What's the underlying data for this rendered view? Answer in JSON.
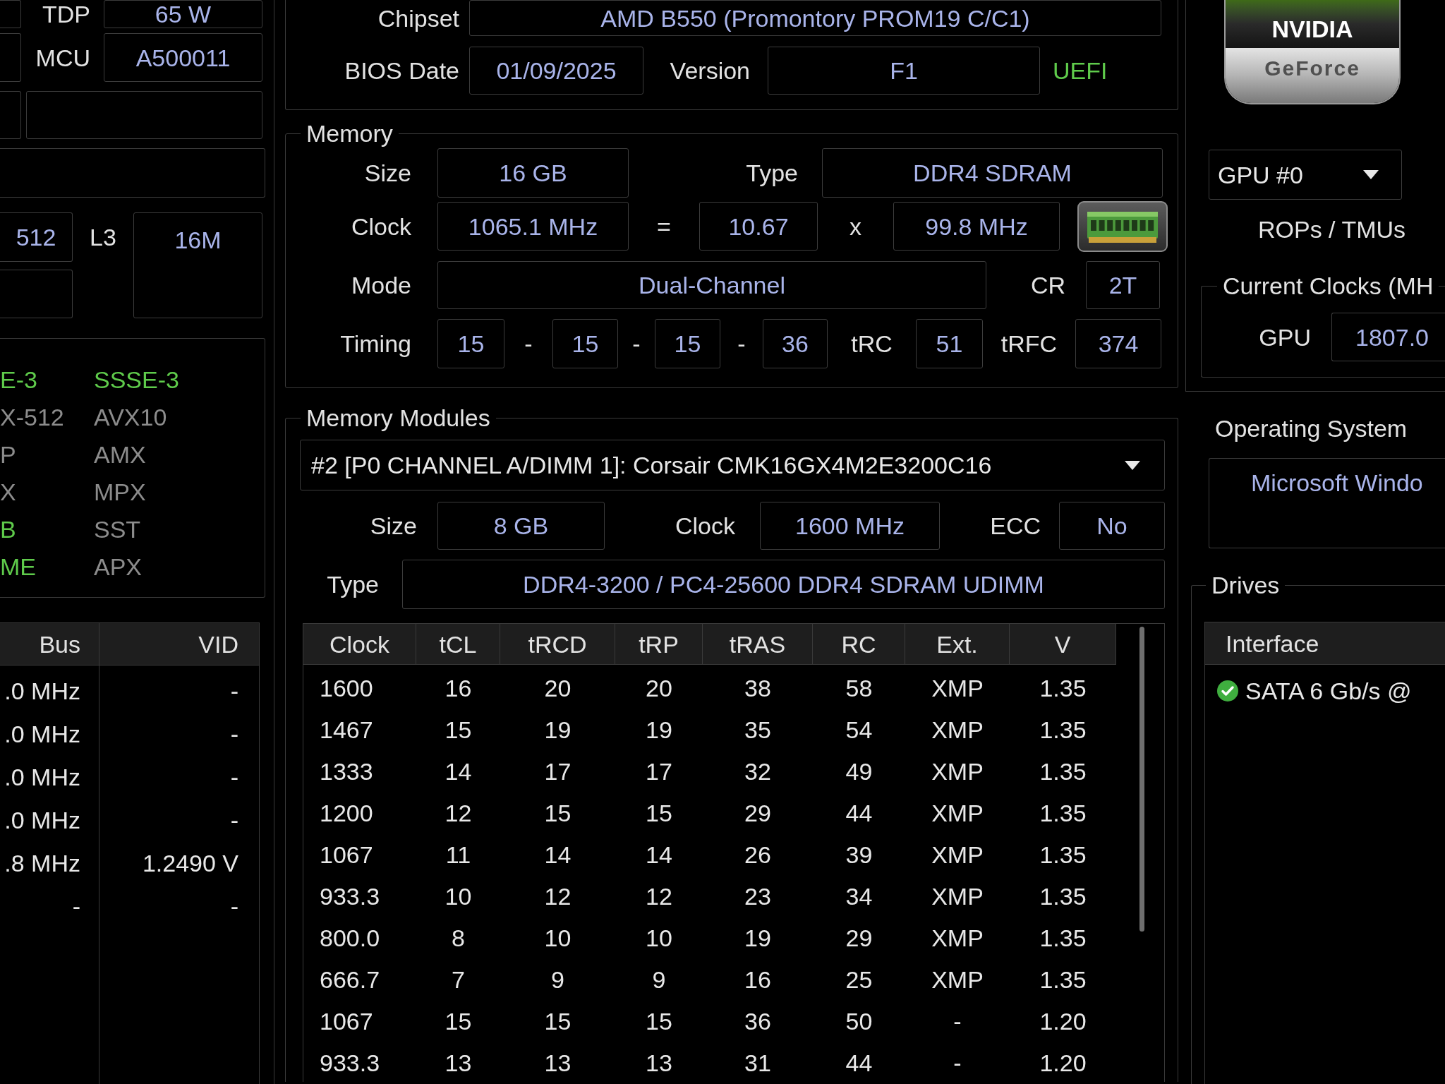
{
  "cpu": {
    "rows": [
      {
        "label": "TDP",
        "value": "65 W"
      },
      {
        "label": "MCU",
        "value": "A500011"
      }
    ],
    "cache": {
      "l2": "512",
      "l3_label": "L3",
      "l3": "16M"
    },
    "features": [
      {
        "name": "E-3",
        "supported": true
      },
      {
        "name": "SSSE-3",
        "supported": true
      },
      {
        "name": "X-512",
        "supported": false
      },
      {
        "name": "AVX10",
        "supported": false
      },
      {
        "name": "P",
        "supported": false
      },
      {
        "name": "AMX",
        "supported": false
      },
      {
        "name": "X",
        "supported": false
      },
      {
        "name": "MPX",
        "supported": false
      },
      {
        "name": "B",
        "supported": true
      },
      {
        "name": "SST",
        "supported": false
      },
      {
        "name": "ME",
        "supported": true
      },
      {
        "name": "APX",
        "supported": false
      }
    ],
    "clocks_table": {
      "columns": [
        "Bus",
        "VID"
      ],
      "rows": [
        [
          ".0 MHz",
          "-"
        ],
        [
          ".0 MHz",
          "-"
        ],
        [
          ".0 MHz",
          "-"
        ],
        [
          ".0 MHz",
          "-"
        ],
        [
          ".8 MHz",
          "1.2490 V"
        ],
        [
          "-",
          "-"
        ]
      ]
    }
  },
  "motherboard": {
    "chipset_label": "Chipset",
    "chipset": "AMD B550 (Promontory PROM19 C/C1)",
    "bios_date_label": "BIOS Date",
    "bios_date": "01/09/2025",
    "version_label": "Version",
    "version": "F1",
    "firmware": "UEFI"
  },
  "memory": {
    "title": "Memory",
    "size_label": "Size",
    "size": "16 GB",
    "type_label": "Type",
    "type": "DDR4 SDRAM",
    "clock_label": "Clock",
    "clock": "1065.1 MHz",
    "equals": "=",
    "multiplier": "10.67",
    "times": "x",
    "base_clock": "99.8 MHz",
    "mode_label": "Mode",
    "mode": "Dual-Channel",
    "cr_label": "CR",
    "cr": "2T",
    "timing_label": "Timing",
    "timings": [
      "15",
      "15",
      "15",
      "36"
    ],
    "timing_separators": [
      "-",
      "-",
      "-"
    ],
    "trc_label": "tRC",
    "trc": "51",
    "trfc_label": "tRFC",
    "trfc": "374"
  },
  "memory_modules": {
    "title": "Memory Modules",
    "selected_module": "#2 [P0 CHANNEL A/DIMM 1]: Corsair CMK16GX4M2E3200C16",
    "size_label": "Size",
    "size": "8 GB",
    "clock_label": "Clock",
    "clock": "1600 MHz",
    "ecc_label": "ECC",
    "ecc": "No",
    "type_label": "Type",
    "type": "DDR4-3200 / PC4-25600 DDR4 SDRAM UDIMM",
    "timings_table": {
      "columns": [
        "Clock",
        "tCL",
        "tRCD",
        "tRP",
        "tRAS",
        "RC",
        "Ext.",
        "V"
      ],
      "rows": [
        [
          "1600",
          "16",
          "20",
          "20",
          "38",
          "58",
          "XMP",
          "1.35"
        ],
        [
          "1467",
          "15",
          "19",
          "19",
          "35",
          "54",
          "XMP",
          "1.35"
        ],
        [
          "1333",
          "14",
          "17",
          "17",
          "32",
          "49",
          "XMP",
          "1.35"
        ],
        [
          "1200",
          "12",
          "15",
          "15",
          "29",
          "44",
          "XMP",
          "1.35"
        ],
        [
          "1067",
          "11",
          "14",
          "14",
          "26",
          "39",
          "XMP",
          "1.35"
        ],
        [
          "933.3",
          "10",
          "12",
          "12",
          "23",
          "34",
          "XMP",
          "1.35"
        ],
        [
          "800.0",
          "8",
          "10",
          "10",
          "19",
          "29",
          "XMP",
          "1.35"
        ],
        [
          "666.7",
          "7",
          "9",
          "9",
          "16",
          "25",
          "XMP",
          "1.35"
        ],
        [
          "1067",
          "15",
          "15",
          "15",
          "36",
          "50",
          "-",
          "1.20"
        ],
        [
          "933.3",
          "13",
          "13",
          "13",
          "31",
          "44",
          "-",
          "1.20"
        ]
      ]
    }
  },
  "gpu": {
    "logo": {
      "brand": "NVIDIA",
      "product": "GeForce"
    },
    "selector": "GPU #0",
    "rops_tmus_label": "ROPs / TMUs",
    "current_clocks": {
      "title": "Current Clocks (MH",
      "gpu_label": "GPU",
      "gpu_clock": "1807.0"
    }
  },
  "operating_system": {
    "title": "Operating System",
    "value": "Microsoft Windo"
  },
  "drives": {
    "title": "Drives",
    "columns": [
      "Interface"
    ],
    "rows": [
      {
        "interface": "SATA 6 Gb/s @",
        "ok": true
      }
    ]
  }
}
